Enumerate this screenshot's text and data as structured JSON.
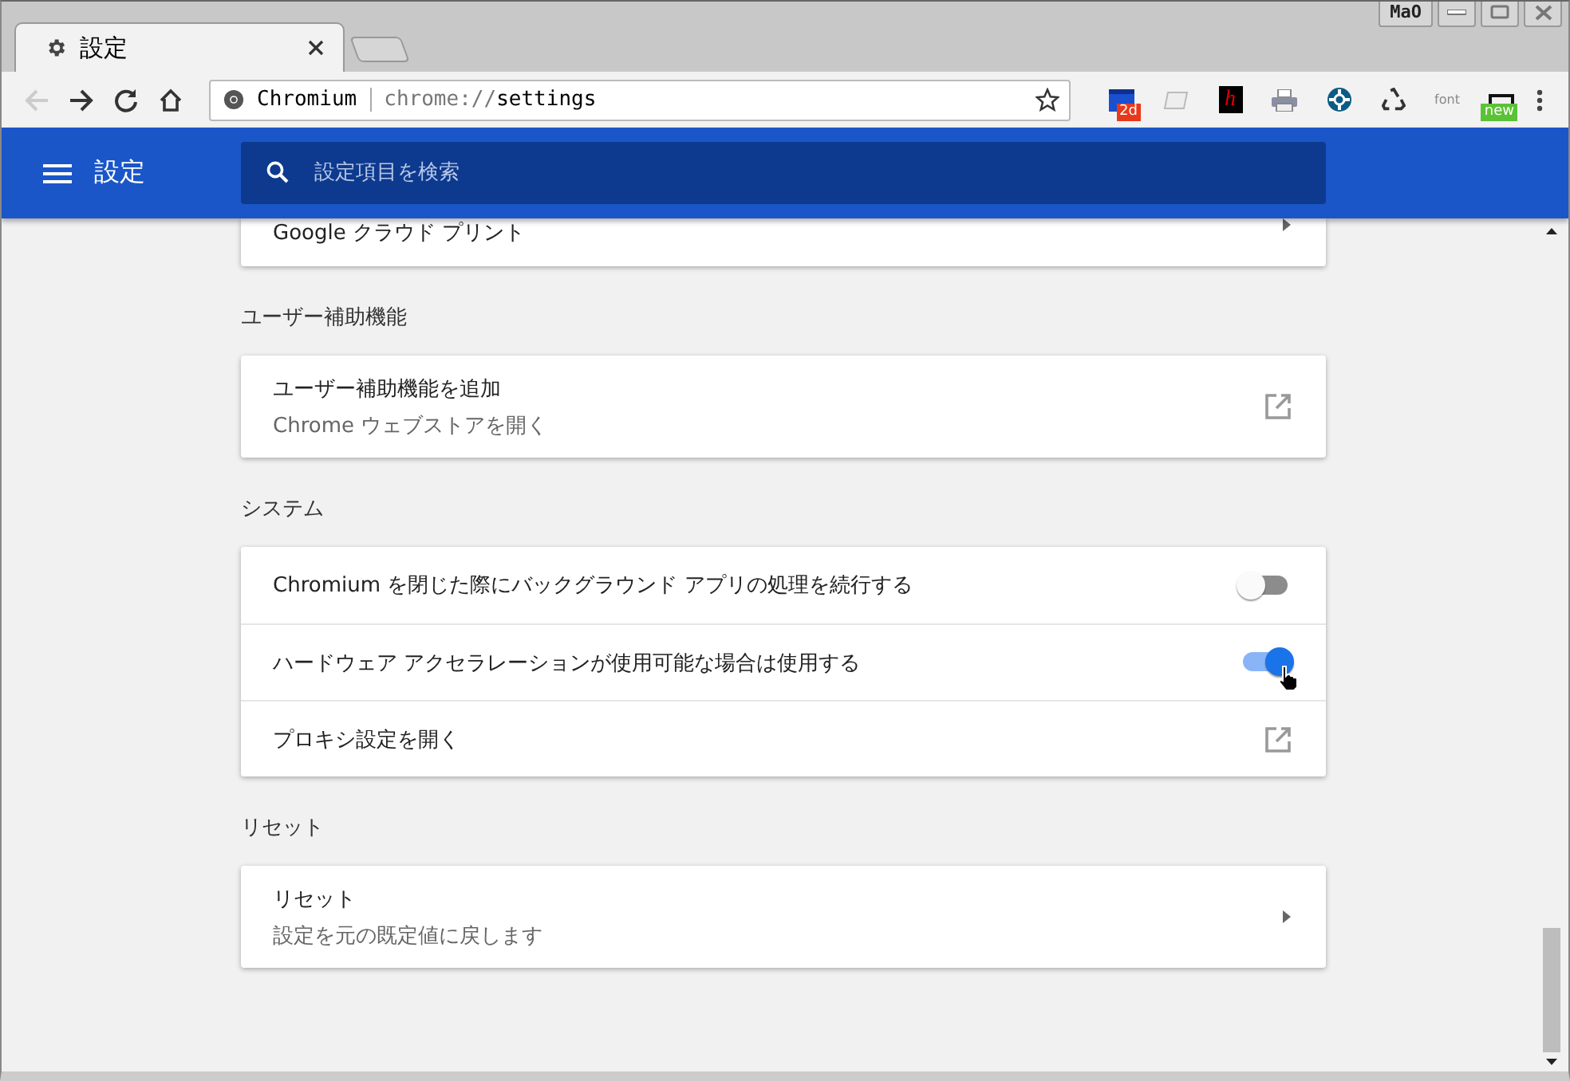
{
  "window": {
    "tab_title": "設定",
    "profile": "MaO"
  },
  "toolbar": {
    "site": "Chromium",
    "url_scheme": "chrome://",
    "url_path": "settings",
    "extensions": [
      {
        "kind": "calendar",
        "badge": "2d"
      },
      {
        "kind": "faded"
      },
      {
        "kind": "letter",
        "text": "h"
      },
      {
        "kind": "printer"
      },
      {
        "kind": "lifebuoy"
      },
      {
        "kind": "recycle"
      },
      {
        "kind": "word",
        "text": "font"
      },
      {
        "kind": "frame",
        "badge": "new"
      }
    ]
  },
  "header": {
    "title": "設定",
    "search_placeholder": "設定項目を検索"
  },
  "sections": [
    {
      "rows": [
        {
          "kind": "arrow",
          "label": "Google クラウド プリント"
        }
      ]
    },
    {
      "title": "ユーザー補助機能",
      "rows": [
        {
          "kind": "external",
          "label": "ユーザー補助機能を追加",
          "sublabel": "Chrome ウェブストアを開く"
        }
      ]
    },
    {
      "title": "システム",
      "rows": [
        {
          "kind": "toggle",
          "label": "Chromium を閉じた際にバックグラウンド アプリの処理を続行する",
          "on": false
        },
        {
          "kind": "toggle",
          "label": "ハードウェア アクセラレーションが使用可能な場合は使用する",
          "on": true,
          "hover": true
        },
        {
          "kind": "external",
          "label": "プロキシ設定を開く"
        }
      ]
    },
    {
      "title": "リセット",
      "rows": [
        {
          "kind": "arrow",
          "label": "リセット",
          "sublabel": "設定を元の既定値に戻します"
        }
      ]
    }
  ]
}
